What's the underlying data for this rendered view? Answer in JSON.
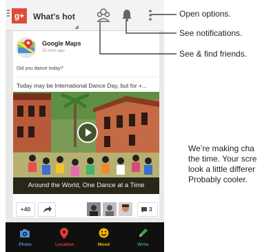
{
  "app": {
    "logo": "g+",
    "stream_title": "What's hot"
  },
  "post": {
    "author": "Google Maps",
    "timestamp": "25 mins ago",
    "question": "Did you dance today?",
    "snippet": "Today may be International Dance Day, but for +...",
    "video_caption": "Around the World, One Dance at a Time",
    "plus_count": "+40",
    "comment_count": "3"
  },
  "tabs": [
    {
      "label": "Photo",
      "color": "#4a90d9",
      "icon": "camera-icon"
    },
    {
      "label": "Location",
      "color": "#e53935",
      "icon": "location-pin-icon"
    },
    {
      "label": "Mood",
      "color": "#f6b400",
      "icon": "smiley-icon"
    },
    {
      "label": "Write",
      "color": "#43a047",
      "icon": "pencil-icon"
    }
  ],
  "callouts": {
    "options": "Open options.",
    "notifications": "See notifications.",
    "friends": "See & find friends."
  },
  "description_lines": [
    "We’re making cha",
    "the time. Your scre",
    "look a little differer",
    "Probably cooler."
  ],
  "colors": {
    "gplus_red": "#dd4b39",
    "bottom_bar": "#101010",
    "header_bg": "#f3f3f3"
  }
}
